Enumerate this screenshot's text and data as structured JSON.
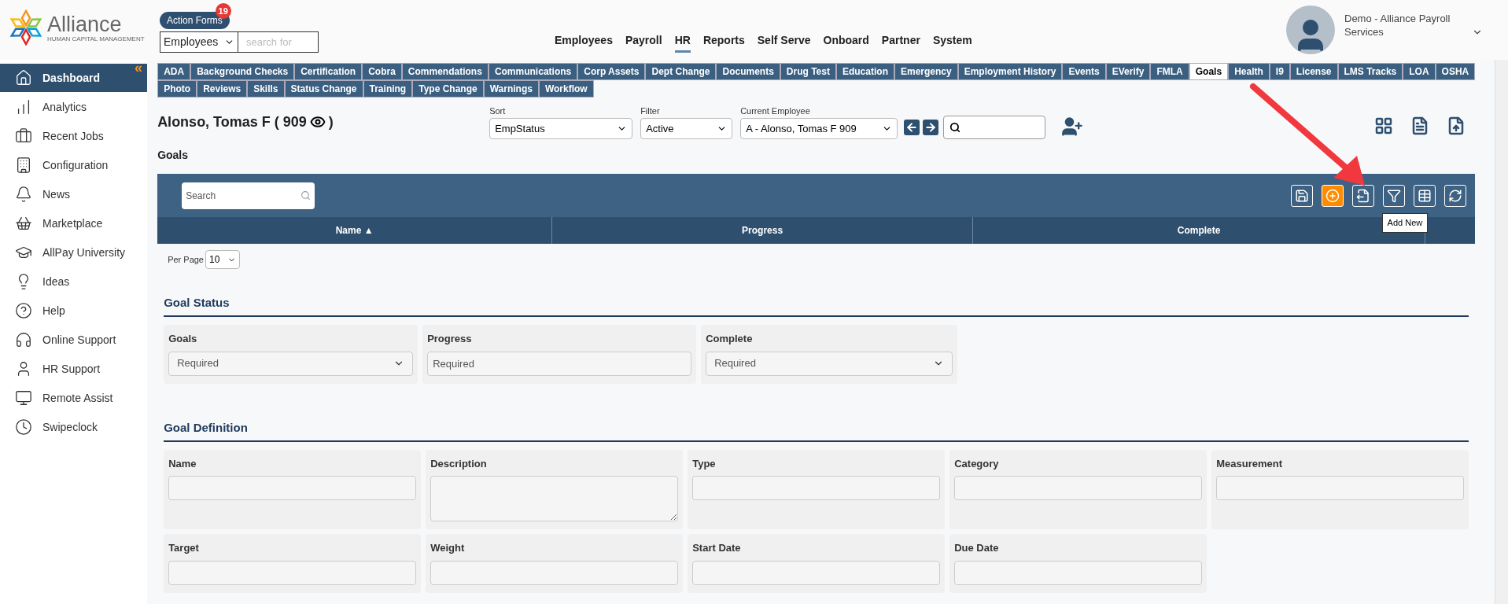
{
  "logo": {
    "name": "Alliance",
    "tagline": "HUMAN CAPITAL MANAGEMENT"
  },
  "action_forms": {
    "label": "Action Forms",
    "count": "19"
  },
  "search": {
    "scope": "Employees",
    "placeholder": "search for"
  },
  "nav": [
    {
      "label": "Employees",
      "selected": false
    },
    {
      "label": "Payroll",
      "selected": false
    },
    {
      "label": "HR",
      "selected": true
    },
    {
      "label": "Reports",
      "selected": false
    },
    {
      "label": "Self Serve",
      "selected": false
    },
    {
      "label": "Onboard",
      "selected": false
    },
    {
      "label": "Partner",
      "selected": false
    },
    {
      "label": "System",
      "selected": false
    }
  ],
  "user": {
    "name": "Demo - Alliance Payroll Services"
  },
  "sidebar": {
    "collapse": "«",
    "items": [
      {
        "label": "Dashboard",
        "selected": true
      },
      {
        "label": "Analytics",
        "selected": false
      },
      {
        "label": "Recent Jobs",
        "selected": false
      },
      {
        "label": "Configuration",
        "selected": false
      },
      {
        "label": "News",
        "selected": false
      },
      {
        "label": "Marketplace",
        "selected": false
      },
      {
        "label": "AllPay University",
        "selected": false
      },
      {
        "label": "Ideas",
        "selected": false
      },
      {
        "label": "Help",
        "selected": false
      },
      {
        "label": "Online Support",
        "selected": false
      },
      {
        "label": "HR Support",
        "selected": false
      },
      {
        "label": "Remote Assist",
        "selected": false
      },
      {
        "label": "Swipeclock",
        "selected": false
      }
    ]
  },
  "tabs": [
    [
      {
        "label": "ADA",
        "selected": false
      },
      {
        "label": "Background Checks",
        "selected": false
      },
      {
        "label": "Certification",
        "selected": false
      },
      {
        "label": "Cobra",
        "selected": false
      },
      {
        "label": "Commendations",
        "selected": false
      },
      {
        "label": "Communications",
        "selected": false
      },
      {
        "label": "Corp Assets",
        "selected": false
      },
      {
        "label": "Dept Change",
        "selected": false
      },
      {
        "label": "Documents",
        "selected": false
      },
      {
        "label": "Drug Test",
        "selected": false
      },
      {
        "label": "Education",
        "selected": false
      },
      {
        "label": "Emergency",
        "selected": false
      },
      {
        "label": "Employment History",
        "selected": false
      },
      {
        "label": "Events",
        "selected": false
      },
      {
        "label": "EVerify",
        "selected": false
      },
      {
        "label": "FMLA",
        "selected": false
      },
      {
        "label": "Goals",
        "selected": true
      },
      {
        "label": "Health",
        "selected": false
      },
      {
        "label": "I9",
        "selected": false
      },
      {
        "label": "License",
        "selected": false
      },
      {
        "label": "LMS Tracks",
        "selected": false
      },
      {
        "label": "LOA",
        "selected": false
      },
      {
        "label": "OSHA",
        "selected": false
      }
    ],
    [
      {
        "label": "Photo",
        "selected": false
      },
      {
        "label": "Reviews",
        "selected": false
      },
      {
        "label": "Skills",
        "selected": false
      },
      {
        "label": "Status Change",
        "selected": false
      },
      {
        "label": "Training",
        "selected": false
      },
      {
        "label": "Type Change",
        "selected": false
      },
      {
        "label": "Warnings",
        "selected": false
      },
      {
        "label": "Workflow",
        "selected": false
      }
    ]
  ],
  "employee": {
    "name": "Alonso, Tomas F ( 909",
    "closing": ")"
  },
  "sort": {
    "label": "Sort",
    "value": "EmpStatus"
  },
  "filter": {
    "label": "Filter",
    "value": "Active"
  },
  "current_employee": {
    "label": "Current Employee",
    "value": "A - Alonso, Tomas F 909"
  },
  "section_title": "Goals",
  "grid": {
    "search_placeholder": "Search",
    "tooltip": "Add New",
    "columns": [
      "Name ▲",
      "Progress",
      "Complete"
    ],
    "per_page_label": "Per Page",
    "per_page": "10"
  },
  "goal_status": {
    "title": "Goal Status",
    "fields": [
      {
        "label": "Goals",
        "kind": "select",
        "value": "Required"
      },
      {
        "label": "Progress",
        "kind": "input",
        "placeholder": "Required"
      },
      {
        "label": "Complete",
        "kind": "select",
        "value": "Required"
      }
    ]
  },
  "goal_definition": {
    "title": "Goal Definition",
    "fields": [
      {
        "label": "Name",
        "kind": "input"
      },
      {
        "label": "Description",
        "kind": "textarea"
      },
      {
        "label": "Type",
        "kind": "input"
      },
      {
        "label": "Category",
        "kind": "input"
      },
      {
        "label": "Measurement",
        "kind": "input"
      },
      {
        "label": "Target",
        "kind": "input"
      },
      {
        "label": "Weight",
        "kind": "input"
      },
      {
        "label": "Start Date",
        "kind": "input"
      },
      {
        "label": "Due Date",
        "kind": "input"
      }
    ]
  }
}
